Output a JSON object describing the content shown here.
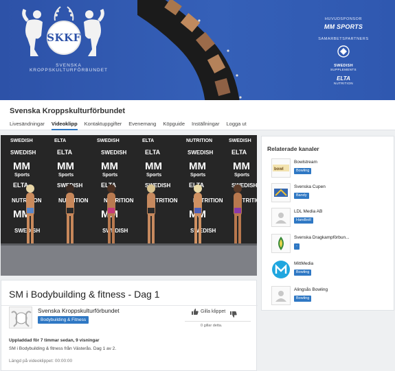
{
  "banner": {
    "logo_text": "SKKF",
    "org_name": "SVENSKA KROPPSKULTURFÖRBUNDET",
    "main_sponsor_label": "HUVUDSPONSOR",
    "main_sponsor": "MM SPORTS",
    "partners_label": "SAMARBETSPARTNERS",
    "partner_1": "SWEDISH",
    "partner_1_sub": "SUPPLEMENTS",
    "partner_2": "ELTA",
    "partner_2_sub": "NUTRITION"
  },
  "channel": {
    "title": "Svenska Kroppskulturförbundet",
    "tabs": [
      {
        "label": "Livesändningar"
      },
      {
        "label": "Videoklipp"
      },
      {
        "label": "Kontaktuppgifter"
      },
      {
        "label": "Evenemang"
      },
      {
        "label": "Köpguide"
      },
      {
        "label": "Inställningar"
      },
      {
        "label": "Logga ut"
      }
    ]
  },
  "video": {
    "title": "SM i Bodybuilding & fitness - Dag 1",
    "owner": "Svenska Kroppskulturförbundet",
    "category": "Bodybuilding & Fitness",
    "like_label": "Gilla klippet",
    "likes_text": "0 gillar detta.",
    "upload_meta": "Uppladdad för 7 timmar sedan, 9 visningar",
    "description": "SM i Bodybuilding & fitness från Västerås. Dag 1 av 2.",
    "length": "Längd på videoklippet: 00:00:00",
    "backdrop_logos": [
      "SWEDISH",
      "ELTA",
      "NUTRITION",
      "MM",
      "Sports"
    ]
  },
  "related": {
    "title": "Relaterade kanaler",
    "items": [
      {
        "name": "Bowlstream",
        "badge": "Bowling"
      },
      {
        "name": "Svenska Cupen",
        "badge": "Bandy"
      },
      {
        "name": "LDL Media AB",
        "badge": "Handboll"
      },
      {
        "name": "Svenska Dragkampförbun...",
        "badge": "-"
      },
      {
        "name": "MittMedia",
        "badge": "Bowling"
      },
      {
        "name": "Alingsås Bowling",
        "badge": "Bowling"
      }
    ]
  }
}
